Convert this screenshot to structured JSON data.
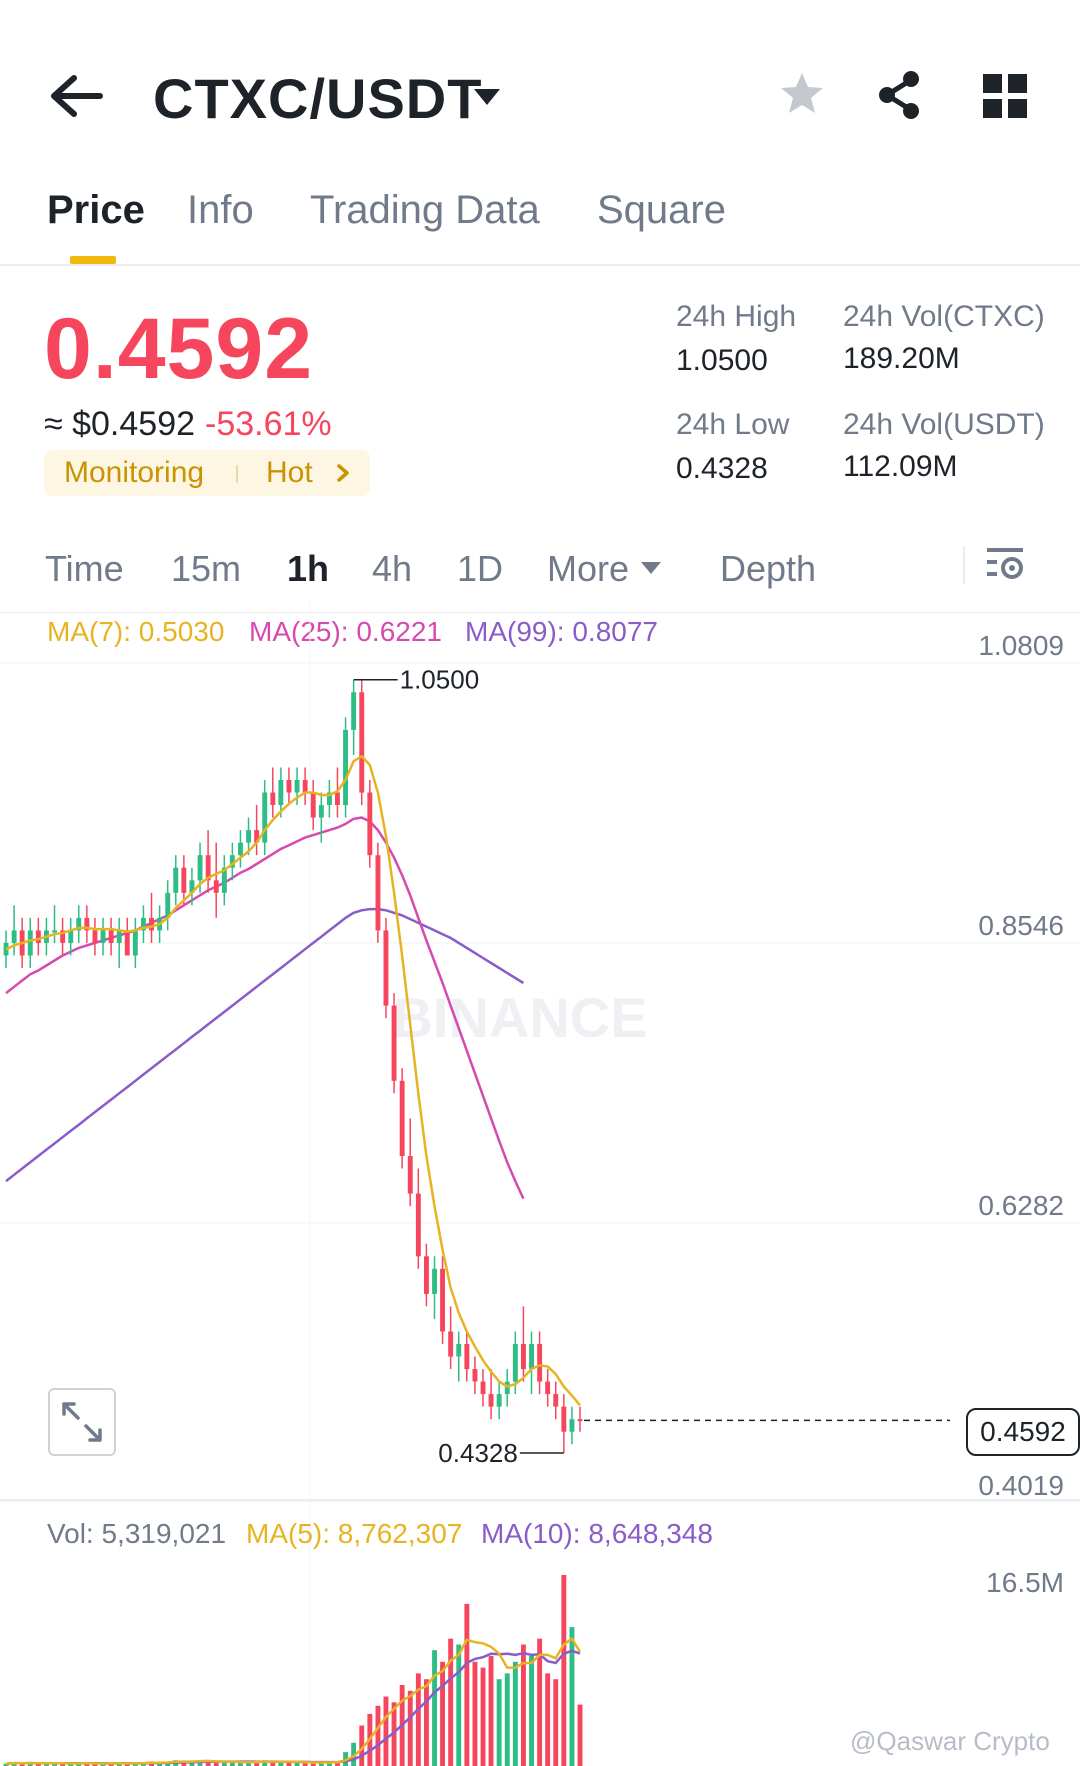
{
  "header": {
    "pair": "CTXC/USDT"
  },
  "tabs": [
    "Price",
    "Info",
    "Trading Data",
    "Square"
  ],
  "price": {
    "last": "0.4592",
    "usd": "≈ $0.4592",
    "change": "-53.61%",
    "tag_monitoring": "Monitoring",
    "tag_hot": "Hot"
  },
  "stats": {
    "high_label": "24h High",
    "high_value": "1.0500",
    "low_label": "24h Low",
    "low_value": "0.4328",
    "vol_base_label": "24h Vol(CTXC)",
    "vol_base_value": "189.20M",
    "vol_quote_label": "24h Vol(USDT)",
    "vol_quote_value": "112.09M"
  },
  "intervals": [
    "Time",
    "15m",
    "1h",
    "4h",
    "1D",
    "More",
    "Depth"
  ],
  "ma_legend": {
    "ma7": "MA(7): 0.5030",
    "ma25": "MA(25): 0.6221",
    "ma99": "MA(99): 0.8077"
  },
  "price_axis": [
    "1.0809",
    "0.8546",
    "0.6282",
    "0.4019"
  ],
  "annotations": {
    "high": "1.0500",
    "low": "0.4328",
    "current": "0.4592"
  },
  "watermark_logo": "BINANCE",
  "volume": {
    "vol": "Vol: 5,319,021",
    "ma5": "MA(5): 8,762,307",
    "ma10": "MA(10): 8,648,348",
    "axis_top": "16.5M"
  },
  "credit": "@Qaswar Crypto",
  "colors": {
    "up": "#2ebd85",
    "down": "#f6465d",
    "ma7": "#e6b422",
    "ma25": "#d64ab0",
    "ma99": "#8a5cc8",
    "accent": "#f0b90b"
  },
  "chart_data": {
    "type": "candlestick",
    "interval": "1h",
    "ylim": [
      0.4019,
      1.0809
    ],
    "candles": [
      [
        0.83,
        0.85,
        0.82,
        0.84
      ],
      [
        0.84,
        0.87,
        0.83,
        0.85
      ],
      [
        0.85,
        0.86,
        0.82,
        0.83
      ],
      [
        0.83,
        0.86,
        0.82,
        0.85
      ],
      [
        0.85,
        0.86,
        0.83,
        0.84
      ],
      [
        0.84,
        0.86,
        0.83,
        0.85
      ],
      [
        0.85,
        0.87,
        0.84,
        0.85
      ],
      [
        0.85,
        0.86,
        0.83,
        0.84
      ],
      [
        0.84,
        0.86,
        0.83,
        0.85
      ],
      [
        0.85,
        0.87,
        0.84,
        0.86
      ],
      [
        0.86,
        0.87,
        0.84,
        0.85
      ],
      [
        0.85,
        0.86,
        0.83,
        0.84
      ],
      [
        0.84,
        0.86,
        0.83,
        0.85
      ],
      [
        0.85,
        0.86,
        0.83,
        0.84
      ],
      [
        0.84,
        0.86,
        0.82,
        0.85
      ],
      [
        0.85,
        0.86,
        0.83,
        0.83
      ],
      [
        0.83,
        0.86,
        0.82,
        0.85
      ],
      [
        0.85,
        0.87,
        0.84,
        0.86
      ],
      [
        0.86,
        0.88,
        0.84,
        0.85
      ],
      [
        0.85,
        0.87,
        0.84,
        0.86
      ],
      [
        0.86,
        0.89,
        0.85,
        0.88
      ],
      [
        0.88,
        0.91,
        0.87,
        0.9
      ],
      [
        0.9,
        0.91,
        0.87,
        0.88
      ],
      [
        0.88,
        0.9,
        0.87,
        0.89
      ],
      [
        0.89,
        0.92,
        0.88,
        0.91
      ],
      [
        0.91,
        0.93,
        0.88,
        0.89
      ],
      [
        0.89,
        0.92,
        0.86,
        0.88
      ],
      [
        0.88,
        0.91,
        0.87,
        0.9
      ],
      [
        0.9,
        0.92,
        0.89,
        0.91
      ],
      [
        0.91,
        0.93,
        0.9,
        0.92
      ],
      [
        0.92,
        0.94,
        0.91,
        0.93
      ],
      [
        0.93,
        0.95,
        0.91,
        0.92
      ],
      [
        0.92,
        0.97,
        0.91,
        0.96
      ],
      [
        0.96,
        0.98,
        0.94,
        0.95
      ],
      [
        0.95,
        0.98,
        0.94,
        0.97
      ],
      [
        0.97,
        0.98,
        0.95,
        0.96
      ],
      [
        0.96,
        0.98,
        0.95,
        0.97
      ],
      [
        0.97,
        0.98,
        0.95,
        0.96
      ],
      [
        0.96,
        0.97,
        0.93,
        0.94
      ],
      [
        0.94,
        0.96,
        0.92,
        0.95
      ],
      [
        0.95,
        0.97,
        0.94,
        0.96
      ],
      [
        0.96,
        0.98,
        0.94,
        0.95
      ],
      [
        0.95,
        1.02,
        0.94,
        1.01
      ],
      [
        1.01,
        1.05,
        0.99,
        1.04
      ],
      [
        1.04,
        1.05,
        0.95,
        0.96
      ],
      [
        0.96,
        0.97,
        0.9,
        0.91
      ],
      [
        0.91,
        0.92,
        0.84,
        0.85
      ],
      [
        0.85,
        0.86,
        0.78,
        0.79
      ],
      [
        0.79,
        0.8,
        0.72,
        0.73
      ],
      [
        0.73,
        0.74,
        0.66,
        0.67
      ],
      [
        0.67,
        0.7,
        0.63,
        0.64
      ],
      [
        0.64,
        0.66,
        0.58,
        0.59
      ],
      [
        0.59,
        0.6,
        0.55,
        0.56
      ],
      [
        0.56,
        0.59,
        0.54,
        0.58
      ],
      [
        0.58,
        0.59,
        0.52,
        0.53
      ],
      [
        0.53,
        0.55,
        0.5,
        0.51
      ],
      [
        0.51,
        0.53,
        0.49,
        0.52
      ],
      [
        0.52,
        0.53,
        0.49,
        0.5
      ],
      [
        0.5,
        0.51,
        0.48,
        0.49
      ],
      [
        0.49,
        0.5,
        0.47,
        0.48
      ],
      [
        0.48,
        0.5,
        0.46,
        0.47
      ],
      [
        0.47,
        0.49,
        0.46,
        0.48
      ],
      [
        0.48,
        0.5,
        0.47,
        0.49
      ],
      [
        0.49,
        0.53,
        0.48,
        0.52
      ],
      [
        0.52,
        0.55,
        0.49,
        0.5
      ],
      [
        0.5,
        0.53,
        0.48,
        0.52
      ],
      [
        0.52,
        0.53,
        0.48,
        0.49
      ],
      [
        0.49,
        0.5,
        0.47,
        0.48
      ],
      [
        0.48,
        0.49,
        0.46,
        0.47
      ],
      [
        0.47,
        0.48,
        0.433,
        0.45
      ],
      [
        0.45,
        0.47,
        0.44,
        0.46
      ],
      [
        0.46,
        0.47,
        0.45,
        0.459
      ]
    ],
    "ma7": [
      0.835,
      0.838,
      0.84,
      0.842,
      0.843,
      0.845,
      0.847,
      0.848,
      0.85,
      0.852,
      0.852,
      0.851,
      0.851,
      0.851,
      0.85,
      0.849,
      0.85,
      0.852,
      0.853,
      0.855,
      0.86,
      0.868,
      0.874,
      0.88,
      0.887,
      0.892,
      0.895,
      0.898,
      0.903,
      0.908,
      0.913,
      0.92,
      0.93,
      0.938,
      0.945,
      0.951,
      0.956,
      0.96,
      0.96,
      0.958,
      0.958,
      0.961,
      0.97,
      0.985,
      0.989,
      0.982,
      0.96,
      0.925,
      0.88,
      0.83,
      0.775,
      0.72,
      0.67,
      0.63,
      0.595,
      0.565,
      0.545,
      0.53,
      0.518,
      0.507,
      0.498,
      0.49,
      0.486,
      0.488,
      0.493,
      0.5,
      0.503,
      0.502,
      0.496,
      0.486,
      0.479,
      0.471
    ],
    "ma25": [
      0.8,
      0.805,
      0.81,
      0.815,
      0.818,
      0.822,
      0.826,
      0.83,
      0.833,
      0.836,
      0.838,
      0.84,
      0.842,
      0.844,
      0.846,
      0.848,
      0.85,
      0.853,
      0.856,
      0.859,
      0.862,
      0.866,
      0.87,
      0.874,
      0.878,
      0.882,
      0.885,
      0.888,
      0.892,
      0.896,
      0.899,
      0.903,
      0.907,
      0.911,
      0.915,
      0.918,
      0.921,
      0.924,
      0.926,
      0.928,
      0.93,
      0.932,
      0.935,
      0.939,
      0.94,
      0.937,
      0.93,
      0.92,
      0.908,
      0.894,
      0.878,
      0.86,
      0.842,
      0.825,
      0.808,
      0.79,
      0.772,
      0.754,
      0.736,
      0.718,
      0.7,
      0.682,
      0.665,
      0.65,
      0.636
    ],
    "ma99": [
      0.65,
      0.655,
      0.66,
      0.665,
      0.67,
      0.675,
      0.68,
      0.685,
      0.69,
      0.695,
      0.7,
      0.705,
      0.71,
      0.715,
      0.72,
      0.725,
      0.73,
      0.735,
      0.74,
      0.745,
      0.75,
      0.755,
      0.76,
      0.765,
      0.77,
      0.775,
      0.78,
      0.785,
      0.79,
      0.795,
      0.8,
      0.805,
      0.81,
      0.815,
      0.82,
      0.825,
      0.83,
      0.835,
      0.84,
      0.845,
      0.85,
      0.855,
      0.86,
      0.864,
      0.866,
      0.867,
      0.867,
      0.866,
      0.864,
      0.862,
      0.859,
      0.856,
      0.853,
      0.85,
      0.847,
      0.844,
      0.84,
      0.836,
      0.832,
      0.828,
      0.824,
      0.82,
      0.816,
      0.812,
      0.808
    ],
    "volume": [
      0.2,
      0.3,
      0.2,
      0.3,
      0.2,
      0.2,
      0.3,
      0.2,
      0.2,
      0.2,
      0.3,
      0.2,
      0.2,
      0.2,
      0.3,
      0.2,
      0.2,
      0.3,
      0.4,
      0.3,
      0.3,
      0.5,
      0.4,
      0.4,
      0.5,
      0.4,
      0.3,
      0.3,
      0.4,
      0.3,
      0.3,
      0.4,
      0.5,
      0.4,
      0.3,
      0.3,
      0.3,
      0.3,
      0.3,
      0.3,
      0.3,
      0.4,
      1.2,
      2.0,
      3.5,
      4.5,
      5.2,
      6.0,
      5.5,
      7.0,
      6.5,
      8.0,
      7.5,
      10.0,
      9.0,
      11.0,
      10.5,
      14.0,
      9.0,
      8.5,
      9.5,
      7.5,
      8.0,
      9.0,
      10.5,
      9.5,
      11.0,
      8.0,
      7.5,
      16.5,
      12.0,
      5.3
    ]
  }
}
